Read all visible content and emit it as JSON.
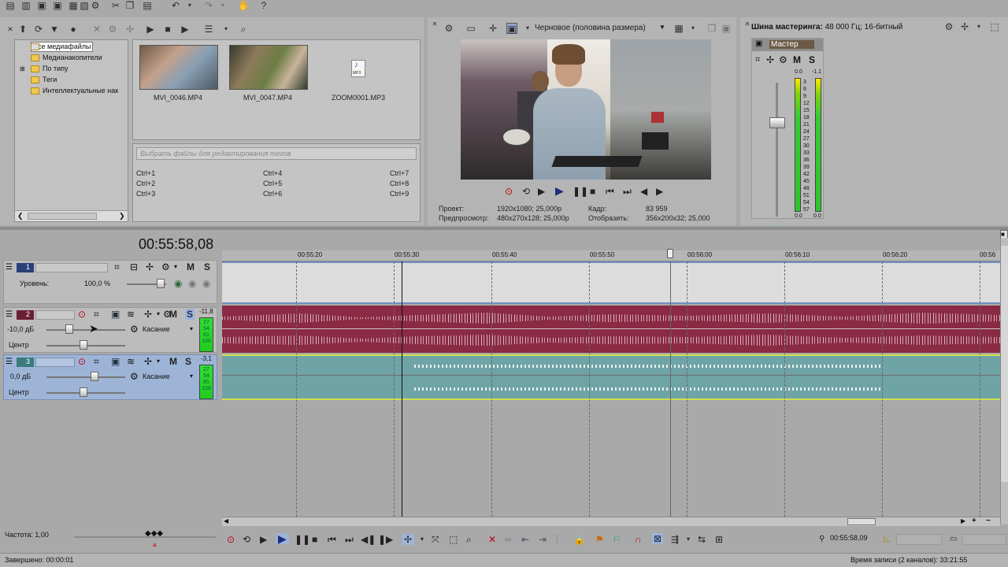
{
  "explorer": {
    "tree": [
      "Все медиафайлы",
      "Медианакопители",
      "По типу",
      "Теги",
      "Интеллектуальные нак"
    ],
    "media": [
      {
        "name": "MVI_0046.MP4",
        "kind": "video"
      },
      {
        "name": "MVI_0047.MP4",
        "kind": "video"
      },
      {
        "name": "ZOOM0001.MP3",
        "kind": "audio",
        "icon_text": "MP3"
      }
    ],
    "tag_placeholder": "Выбрать файлы для редактирования тегов",
    "shortcuts": [
      [
        "Ctrl+1",
        "Ctrl+4",
        "Ctrl+7"
      ],
      [
        "Ctrl+2",
        "Ctrl+5",
        "Ctrl+8"
      ],
      [
        "Ctrl+3",
        "Ctrl+6",
        "Ctrl+9"
      ]
    ]
  },
  "preview": {
    "quality": "Черновое (половина размера)",
    "project_label": "Проект:",
    "project_value": "1920x1080; 25,000p",
    "preview_label": "Предпросмотр:",
    "preview_value": "480x270x128; 25,000p",
    "frame_label": "Кадр:",
    "frame_value": "83 959",
    "display_label": "Отобразить:",
    "display_value": "356x200x32; 25,000"
  },
  "mastering": {
    "title": "Шина мастеринга:",
    "format": "48 000 Гц; 16-битный",
    "master_label": "Мастер",
    "peak_left": "0.0",
    "peak_right": "-1.1",
    "scale": [
      "3",
      "6",
      "9",
      "12",
      "15",
      "18",
      "21",
      "24",
      "27",
      "30",
      "33",
      "36",
      "39",
      "42",
      "45",
      "48",
      "51",
      "54",
      "57"
    ],
    "bottom_left": "0.0",
    "bottom_right": "0.0"
  },
  "timeline": {
    "timecode": "00:55:58,08",
    "ruler": [
      "00:55:20",
      "00:55:30",
      "00:55:40",
      "00:55:50",
      "00:56:00",
      "00:56:10",
      "00:56:20",
      "00:56:30"
    ],
    "ruler_edge": "00:56",
    "tracks": [
      {
        "num": "1",
        "level_label": "Уровень:",
        "level_value": "100,0 %"
      },
      {
        "num": "2",
        "vol": "-10,0 дБ",
        "pan": "Центр",
        "mode": "Касание",
        "peak": "-11,8",
        "meter": [
          "27",
          "54",
          "81",
          "108"
        ]
      },
      {
        "num": "3",
        "vol": "0,0 дБ",
        "pan": "Центр",
        "mode": "Касание",
        "peak": "-3,1",
        "meter": [
          "27",
          "54",
          "81",
          "108"
        ]
      }
    ],
    "mute_label": "M",
    "solo_label": "S"
  },
  "bottom": {
    "rate_label": "Частота: 1,00",
    "status_left": "Завершено: 00:00:01",
    "cursor_time": "00:55:58,09",
    "status_right": "Время записи (2 каналов): 33:21:55"
  },
  "colors": {
    "audio_red": "#8a2a45",
    "audio_teal": "#6fa4a6",
    "video_track": "#dcdcdc",
    "track_select": "#9db4d6"
  }
}
